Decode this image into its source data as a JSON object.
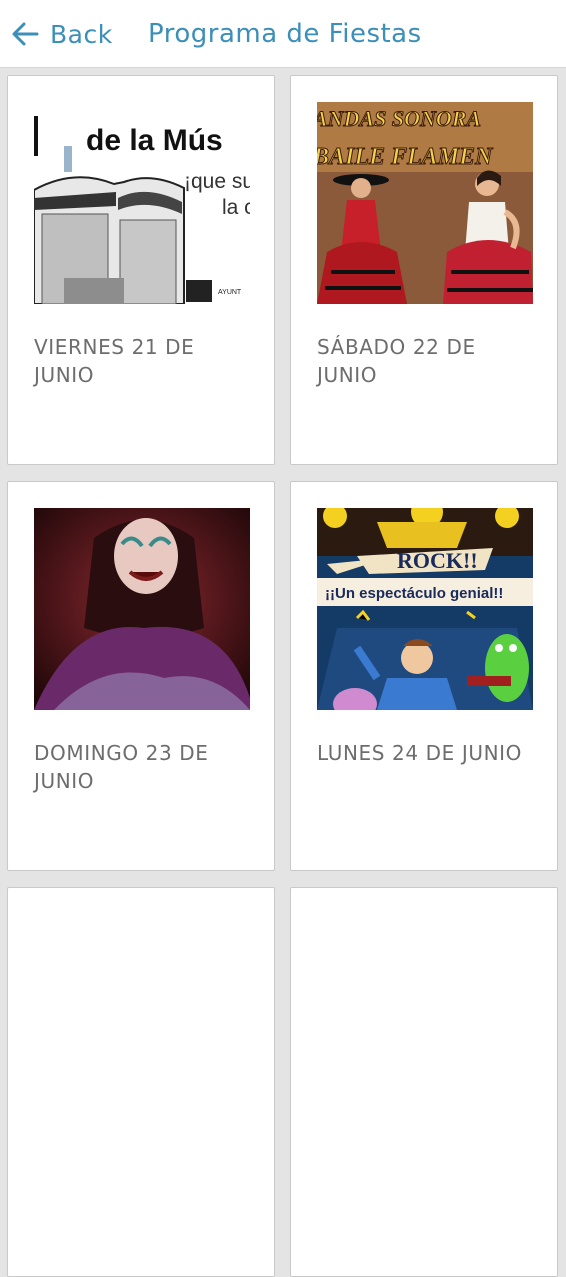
{
  "header": {
    "back_label": "Back",
    "title": "Programa de Fiestas"
  },
  "colors": {
    "accent": "#3c8fb8",
    "card_text": "#6d6d6d",
    "background": "#e4e4e4"
  },
  "cards": [
    {
      "label": "VIERNES 21 DE JUNIO",
      "poster_text": [
        "de la Mús",
        "¡que su",
        "la c",
        "AYUNT"
      ]
    },
    {
      "label": "SÁBADO 22 DE JUNIO",
      "poster_text": [
        "ANDAS SONORA",
        "BAILE FLAMEN"
      ]
    },
    {
      "label": "DOMINGO 23 DE JUNIO",
      "poster_text": []
    },
    {
      "label": "LUNES 24 DE JUNIO",
      "poster_text": [
        "ROCK!!",
        "¡¡Un espectáculo genial!!"
      ]
    }
  ]
}
